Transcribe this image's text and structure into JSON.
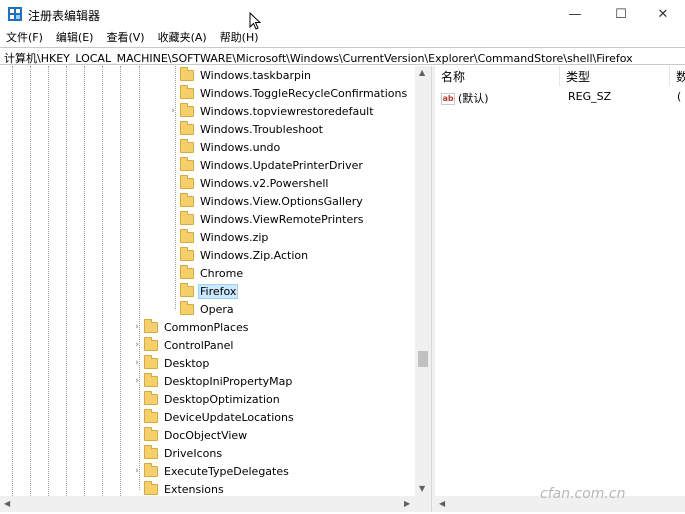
{
  "window": {
    "title": "注册表编辑器",
    "controls": {
      "minimize": "—",
      "maximize": "☐",
      "close": "✕"
    }
  },
  "menu": [
    "文件(F)",
    "编辑(E)",
    "查看(V)",
    "收藏夹(A)",
    "帮助(H)"
  ],
  "address": "计算机\\HKEY_LOCAL_MACHINE\\SOFTWARE\\Microsoft\\Windows\\CurrentVersion\\Explorer\\CommandStore\\shell\\Firefox",
  "tree": {
    "inner_items": [
      {
        "label": "Windows.taskbarpin",
        "expandable": false
      },
      {
        "label": "Windows.ToggleRecycleConfirmations",
        "expandable": false
      },
      {
        "label": "Windows.topviewrestoredefault",
        "expandable": true
      },
      {
        "label": "Windows.Troubleshoot",
        "expandable": false
      },
      {
        "label": "Windows.undo",
        "expandable": false
      },
      {
        "label": "Windows.UpdatePrinterDriver",
        "expandable": false
      },
      {
        "label": "Windows.v2.Powershell",
        "expandable": false
      },
      {
        "label": "Windows.View.OptionsGallery",
        "expandable": false
      },
      {
        "label": "Windows.ViewRemotePrinters",
        "expandable": false
      },
      {
        "label": "Windows.zip",
        "expandable": false
      },
      {
        "label": "Windows.Zip.Action",
        "expandable": false
      },
      {
        "label": "Chrome",
        "expandable": false
      },
      {
        "label": "Firefox",
        "expandable": false,
        "selected": true
      },
      {
        "label": "Opera",
        "expandable": false
      }
    ],
    "outer_items": [
      {
        "label": "CommonPlaces",
        "expandable": true
      },
      {
        "label": "ControlPanel",
        "expandable": true
      },
      {
        "label": "Desktop",
        "expandable": true
      },
      {
        "label": "DesktopIniPropertyMap",
        "expandable": true
      },
      {
        "label": "DesktopOptimization",
        "expandable": false
      },
      {
        "label": "DeviceUpdateLocations",
        "expandable": false
      },
      {
        "label": "DocObjectView",
        "expandable": false
      },
      {
        "label": "DriveIcons",
        "expandable": false
      },
      {
        "label": "ExecuteTypeDelegates",
        "expandable": true
      },
      {
        "label": "Extensions",
        "expandable": false
      }
    ]
  },
  "values": {
    "columns": [
      "名称",
      "类型",
      "数"
    ],
    "rows": [
      {
        "name": "(默认)",
        "type": "REG_SZ",
        "data": "("
      }
    ],
    "icon_text": "ab"
  },
  "watermark": "cfan.com.cn"
}
